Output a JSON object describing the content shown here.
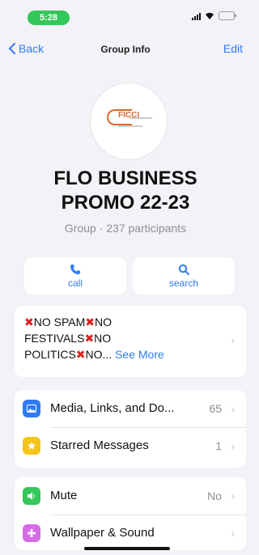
{
  "status_bar": {
    "time": "5:28"
  },
  "nav": {
    "back_label": "Back",
    "title": "Group Info",
    "edit_label": "Edit"
  },
  "group": {
    "name_line1": "FLO BUSINESS",
    "name_line2": "PROMO 22-23",
    "subtitle": "Group · 237 participants"
  },
  "actions": {
    "call_label": "call",
    "search_label": "search"
  },
  "description": {
    "seg1": "NO SPAM",
    "seg2": "NO",
    "seg3": "FESTIVALS",
    "seg4": "NO",
    "seg5": "POLITICS",
    "seg6": "NO...",
    "see_more": "See More"
  },
  "rows": {
    "media": {
      "label": "Media, Links, and Do...",
      "value": "65"
    },
    "starred": {
      "label": "Starred Messages",
      "value": "1"
    },
    "mute": {
      "label": "Mute",
      "value": "No"
    },
    "wallpaper": {
      "label": "Wallpaper & Sound"
    }
  },
  "colors": {
    "accent": "#2f7bf5",
    "status_green": "#34c759",
    "media_icon": "#2f7bf5",
    "starred_icon": "#f5c518",
    "mute_icon": "#34c759",
    "wallpaper_icon": "#d66be6",
    "red_x": "#e02020"
  },
  "icons": {
    "back": "chevron-left-icon",
    "call": "phone-icon",
    "search": "magnifier-icon",
    "media": "photo-icon",
    "starred": "star-icon",
    "mute": "speaker-icon",
    "wallpaper": "flower-icon"
  }
}
